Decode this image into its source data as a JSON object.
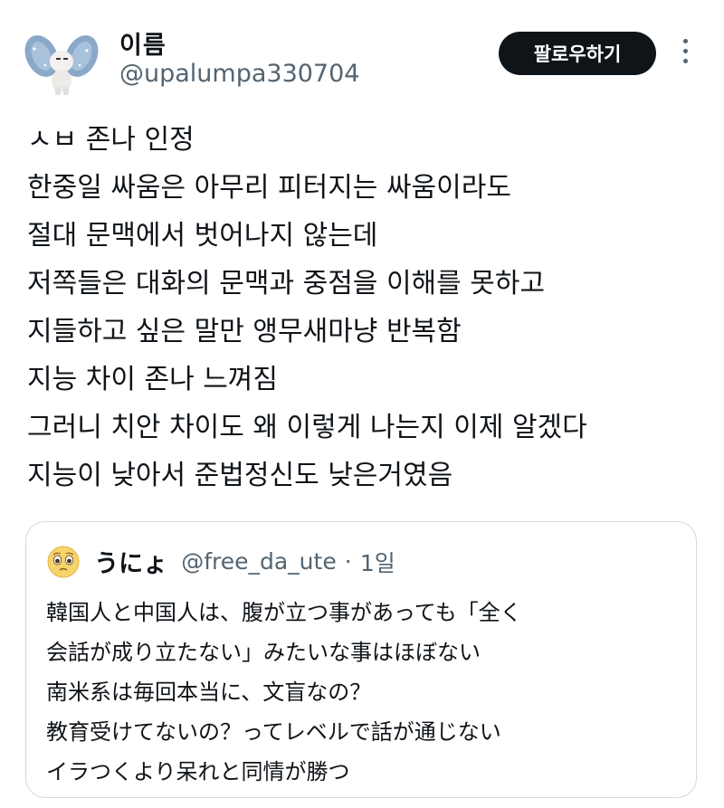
{
  "author": {
    "name": "이름",
    "handle": "@upalumpa330704",
    "avatar_icon": "bunny-character-avatar-icon"
  },
  "follow_button": {
    "label": "팔로우하기"
  },
  "more_icon": "three-dots-vertical-icon",
  "tweet": {
    "lines": [
      "ㅅㅂ 존나 인정",
      "한중일 싸움은 아무리 피터지는 싸움이라도",
      "절대 문맥에서 벗어나지 않는데",
      "저쪽들은 대화의 문맥과 중점을 이해를 못하고",
      "지들하고 싶은 말만 앵무새마냥 반복함",
      "지능 차이 존나 느껴짐",
      "그러니 치안 차이도 왜 이렇게 나는지 이제 알겠다",
      "지능이 낮아서 준법정신도 낮은거였음"
    ]
  },
  "quote": {
    "avatar_icon": "pleading-face-emoji-icon",
    "name": "うにょ",
    "handle": "@free_da_ute",
    "separator": "·",
    "time": "1일",
    "lines": [
      "韓国人と中国人は、腹が立つ事があっても「全く",
      "会話が成り立たない」みたいな事はほぼない",
      "南米系は毎回本当に、文盲なの？",
      "教育受けてないの？ってレベルで話が通じない",
      "イラつくより呆れと同情が勝つ"
    ]
  },
  "colors": {
    "text": "#0f1419",
    "secondary_text": "#536471",
    "button_bg": "#0f1419",
    "button_text": "#ffffff",
    "border": "#cfd9de"
  }
}
